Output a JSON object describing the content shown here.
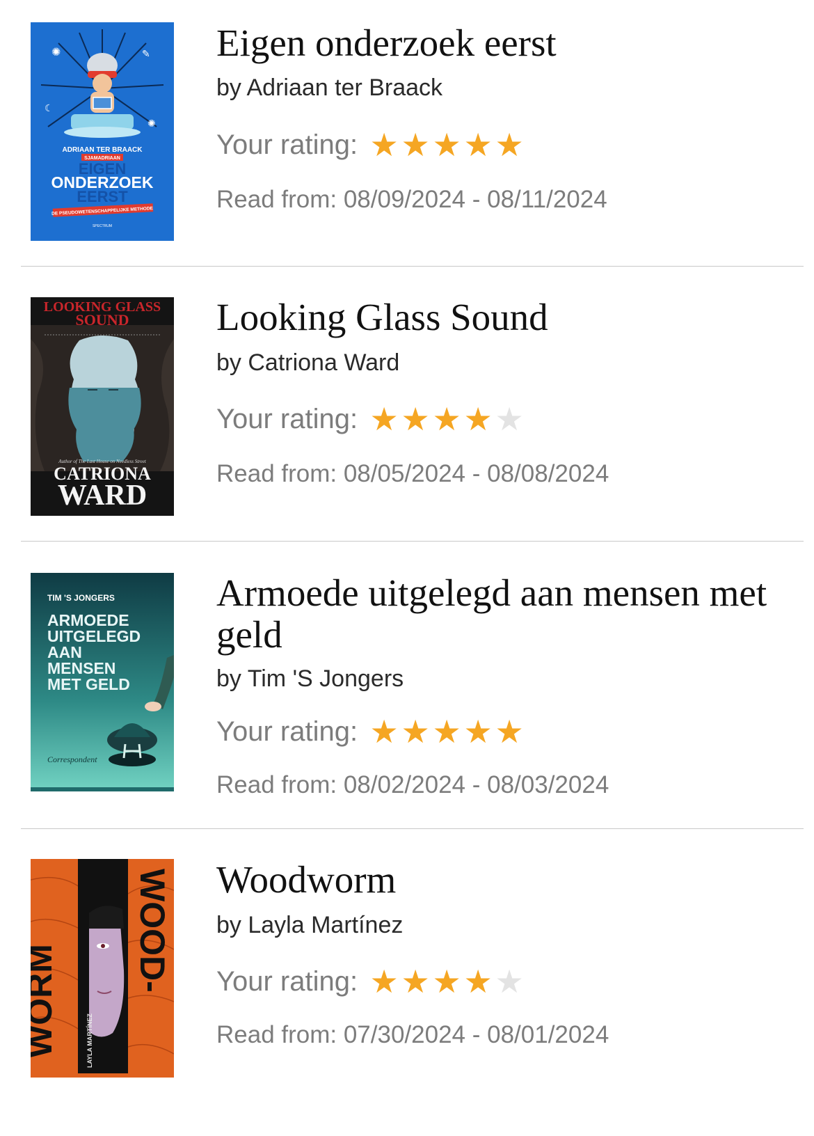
{
  "books": [
    {
      "title": "Eigen onderzoek eerst",
      "author": "by Adriaan ter Braack",
      "rating_label": "Your rating:",
      "rating": 5,
      "rating_max": 5,
      "read_dates": "Read from: 08/09/2024 - 08/11/2024",
      "cover": {
        "author": "ADRIAAN TER BRAACK",
        "tag": "SJAMADRIAAN",
        "line1": "EIGEN",
        "line2": "ONDERZOEK",
        "line3": "EERST",
        "subtitle": "DE PSEUDOWETENSCHAPPELIJKE METHODE",
        "publisher": "SPECTRUM",
        "bg_color": "#1d6fd0"
      }
    },
    {
      "title": "Looking Glass Sound",
      "author": "by Catriona Ward",
      "rating_label": "Your rating:",
      "rating": 4,
      "rating_max": 5,
      "read_dates": "Read from: 08/05/2024 - 08/08/2024",
      "cover": {
        "title1": "LOOKING GLASS",
        "title2": "SOUND",
        "blurb": "Author of The Last House on Needless Street",
        "name1": "CATRIONA",
        "name2": "WARD",
        "bg_color": "#141414",
        "title_color": "#c9262b"
      }
    },
    {
      "title": "Armoede uitgelegd aan mensen met geld",
      "author": "by Tim 'S Jongers",
      "rating_label": "Your rating:",
      "rating": 5,
      "rating_max": 5,
      "read_dates": "Read from: 08/02/2024 - 08/03/2024",
      "cover": {
        "author": "TIM 'S JONGERS",
        "line1": "ARMOEDE",
        "line2": "UITGELEGD",
        "line3": "AAN",
        "line4": "MENSEN",
        "line5": "MET GELD",
        "publisher": "Correspondent",
        "bg_color": "#1f6b6b"
      }
    },
    {
      "title": "Woodworm",
      "author": "by Layla Martínez",
      "rating_label": "Your rating:",
      "rating": 4,
      "rating_max": 5,
      "read_dates": "Read from: 07/30/2024 - 08/01/2024",
      "cover": {
        "word1": "WOOD-",
        "word2": "WORM",
        "author": "LAYLA MARTÍNEZ",
        "bg_color": "#e0621f"
      }
    }
  ],
  "colors": {
    "star_filled": "#f5a623",
    "star_empty": "#e3e3e3",
    "divider": "#c8c8c8"
  }
}
